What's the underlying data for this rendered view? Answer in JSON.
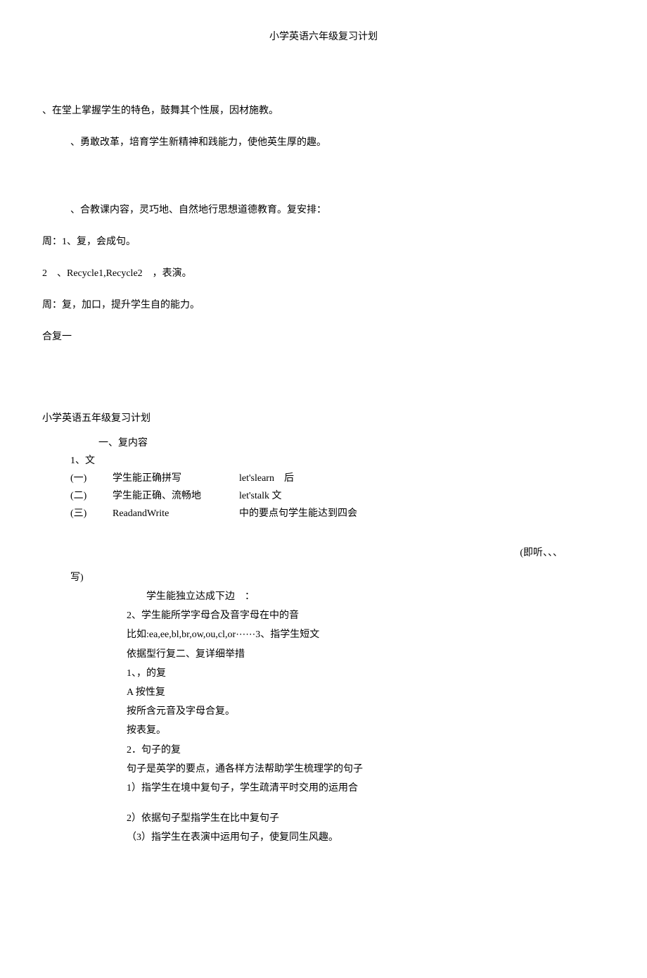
{
  "header": "小学英语六年级复习计划",
  "p1": "、在堂上掌握学生的特色，鼓舞其个性展，因材施教。",
  "p2": "、勇敢改革，培育学生新精神和践能力，使他英生厚的趣。",
  "p3": "、合教课内容，灵巧地、自然地行思想道德教育。复安排：",
  "p4": "周：1、复，会成句。",
  "p5": "2　、Recycle1,Recycle2　，表演。",
  "p6": "周：复，加口，提升学生自的能力。",
  "p7": "合复一",
  "subtitle": "小学英语五年级复习计划",
  "sec1_title": "一、复内容",
  "sec1_l1": "1、文",
  "rows": [
    {
      "c1": "(一)",
      "c2": "学生能正确拼写",
      "c3": "let'slearn　后"
    },
    {
      "c1": "(二)",
      "c2": "学生能正确、流畅地",
      "c3": "let'stalk 文"
    },
    {
      "c1": "(三)",
      "c2": "ReadandWrite",
      "c3": "中的要点句学生能达到四会"
    }
  ],
  "right_note": "(即听、、、",
  "write_label": "写)",
  "body": [
    "　　学生能独立达成下边　：",
    "2、学生能所学字母合及音字母在中的音",
    "比如:ea,ee,bl,br,ow,ou,cl,or⋯⋯3、指学生短文",
    "依据型行复二、复详细举措",
    "1、，的复",
    "A 按性复",
    "按所含元音及字母合复。",
    "按表复。",
    "2．句子的复",
    "句子是英学的要点，通各样方法帮助学生梳理学的句子",
    "1）指学生在境中复句子，学生疏清平时交用的运用合"
  ],
  "body2": [
    "2）依据句子型指学生在比中复句子",
    "（3）指学生在表演中运用句子，使复同生风趣。"
  ]
}
